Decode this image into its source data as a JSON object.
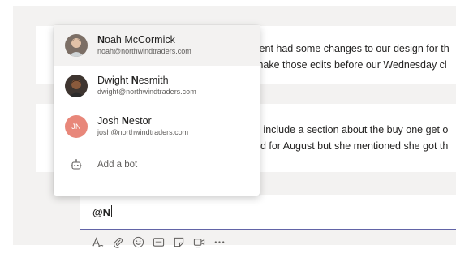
{
  "messages": [
    {
      "text": "lient had some changes to our design for th",
      "text2": "make those edits before our Wednesday cl"
    },
    {
      "text": "o include a section about the buy one get o",
      "text2": "ed for August but she mentioned she got th"
    }
  ],
  "mention_popup": {
    "suggestions": [
      {
        "match": "N",
        "rest": "oah McCormick",
        "prefix": "",
        "email": "noah@northwindtraders.com",
        "avatar": "photo"
      },
      {
        "prefix": "Dwight ",
        "match": "N",
        "rest": "esmith",
        "email": "dwight@northwindtraders.com",
        "avatar": "photo"
      },
      {
        "prefix": "Josh ",
        "match": "N",
        "rest": "estor",
        "email": "josh@northwindtraders.com",
        "avatar": "initials",
        "initials": "JN"
      }
    ],
    "add_bot_label": "Add a bot"
  },
  "composer": {
    "value": "@N"
  },
  "toolbar": {
    "icons": [
      "format-icon",
      "attach-icon",
      "emoji-icon",
      "gif-icon",
      "sticker-icon",
      "meet-icon",
      "more-icon"
    ]
  },
  "colors": {
    "accent": "#6264a7",
    "initials_avatar": "#e8877a",
    "pane_bg": "#f3f2f1"
  }
}
